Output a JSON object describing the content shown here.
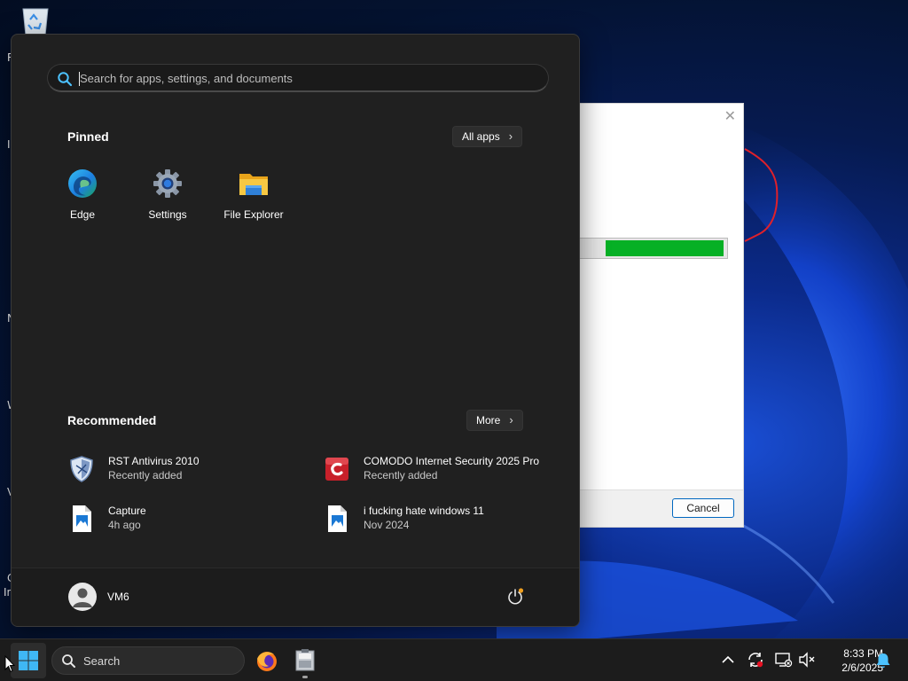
{
  "desktop": {
    "side_letters": [
      "R",
      "I",
      "N",
      "W",
      "V",
      "C",
      "In"
    ]
  },
  "dialog": {
    "close_glyph": "✕",
    "progress_fraction": 0.8,
    "cancel_label": "Cancel"
  },
  "start_menu": {
    "search": {
      "placeholder": "Search for apps, settings, and documents",
      "icon": "search-icon"
    },
    "pinned": {
      "title": "Pinned",
      "all_apps_label": "All apps",
      "apps": [
        {
          "label": "Edge",
          "icon": "edge-icon"
        },
        {
          "label": "Settings",
          "icon": "settings-gear-icon"
        },
        {
          "label": "File Explorer",
          "icon": "file-explorer-folder-icon"
        }
      ]
    },
    "recommended": {
      "title": "Recommended",
      "more_label": "More",
      "items": [
        {
          "title": "RST Antivirus 2010",
          "subtitle": "Recently added",
          "icon": "shield-icon"
        },
        {
          "title": "COMODO Internet Security 2025 Pro",
          "subtitle": "Recently added",
          "icon": "comodo-icon"
        },
        {
          "title": "Capture",
          "subtitle": "4h ago",
          "icon": "image-file-icon"
        },
        {
          "title": "i fucking hate windows 11",
          "subtitle": "Nov 2024",
          "icon": "image-file-icon"
        }
      ]
    },
    "user": {
      "name": "VM6",
      "icon": "user-avatar-icon"
    },
    "power_icon": "power-icon"
  },
  "taskbar": {
    "search_label": "Search",
    "apps": [
      {
        "name": "Firefox",
        "icon": "firefox-icon"
      },
      {
        "name": "Installer",
        "icon": "installer-icon"
      }
    ],
    "tray": {
      "time": "8:33 PM",
      "date": "2/6/2025"
    }
  },
  "colors": {
    "start_bg": "#202020",
    "accent_blue": "#0067c0",
    "progress_green": "#06b025",
    "taskbar_bg": "#1c1c1c"
  }
}
